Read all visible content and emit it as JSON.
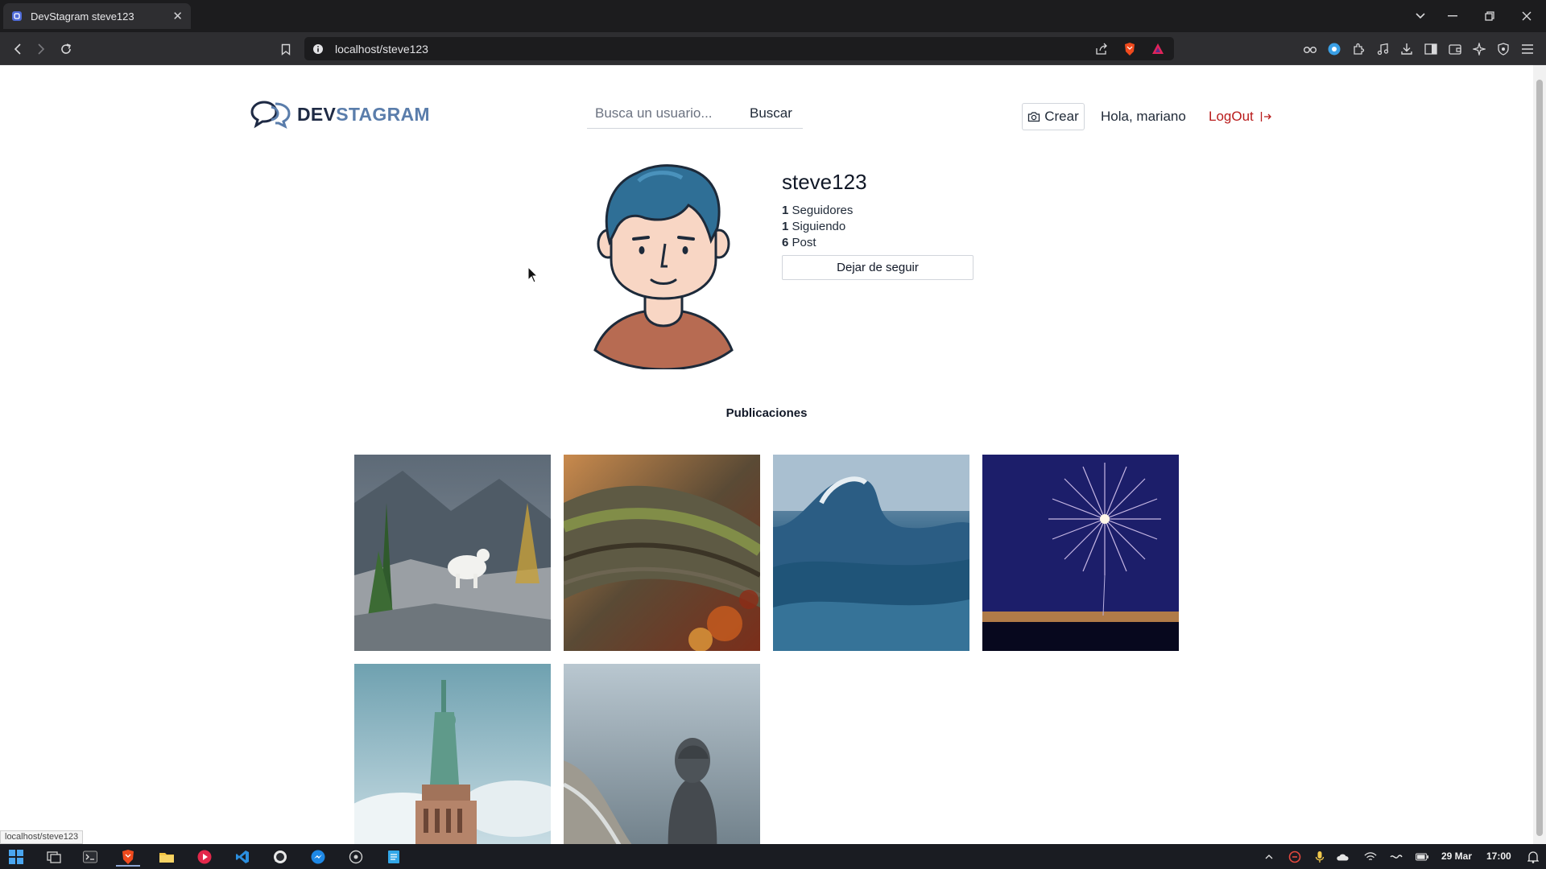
{
  "browser": {
    "tab_title": "DevStagram steve123",
    "url": "localhost/steve123",
    "status_url": "localhost/steve123"
  },
  "header": {
    "logo_dev": "DEV",
    "logo_stagram": "STAGRAM",
    "search_placeholder": "Busca un usuario...",
    "search_button": "Buscar",
    "create_button": "Crear",
    "greeting": "Hola, mariano",
    "logout": "LogOut"
  },
  "profile": {
    "username": "steve123",
    "followers_count": "1",
    "followers_label": "Seguidores",
    "following_count": "1",
    "following_label": "Siguiendo",
    "posts_count": "6",
    "posts_label": "Post",
    "unfollow_button": "Dejar de seguir"
  },
  "posts_section": {
    "title": "Publicaciones"
  },
  "taskbar": {
    "date": "29 Mar",
    "time": "17:00"
  },
  "colors": {
    "accent_red": "#b91c1c",
    "logo_dark": "#1e2a44",
    "logo_blue": "#5a7dab"
  }
}
